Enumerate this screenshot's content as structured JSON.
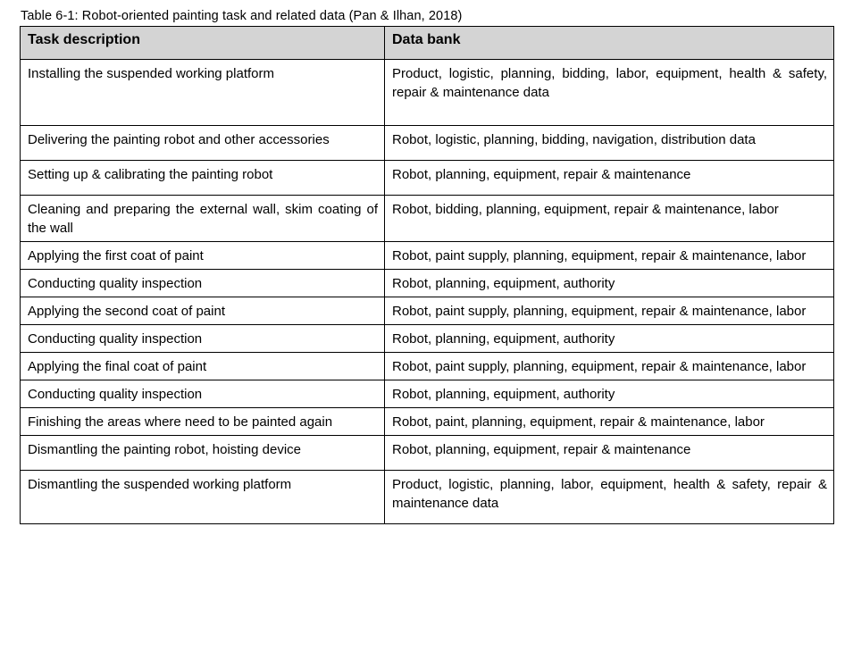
{
  "caption": "Table 6-1: Robot-oriented painting task and related data (Pan & Ilhan, 2018)",
  "table": {
    "headers": {
      "task": "Task description",
      "data_bank": "Data bank"
    },
    "rows": [
      {
        "task": "Installing the suspended working platform",
        "data_bank": "Product, logistic, planning, bidding, labor, equipment, health & safety, repair & maintenance data"
      },
      {
        "task": "Delivering the painting robot and other accessories",
        "data_bank": "Robot, logistic, planning, bidding, navigation, distribution data"
      },
      {
        "task": "Setting up & calibrating the painting robot",
        "data_bank": "Robot, planning, equipment,  repair & maintenance"
      },
      {
        "task": "Cleaning and preparing the external wall, skim coating of the wall",
        "data_bank": "Robot, bidding, planning, equipment,  repair & maintenance, labor"
      },
      {
        "task": "Applying the first coat of paint",
        "data_bank": "Robot, paint supply, planning, equipment,  repair & maintenance, labor"
      },
      {
        "task": "Conducting quality inspection",
        "data_bank": "Robot, planning, equipment, authority"
      },
      {
        "task": "Applying the second coat of paint",
        "data_bank": "Robot, paint supply, planning, equipment,  repair & maintenance, labor"
      },
      {
        "task": "Conducting quality inspection",
        "data_bank": "Robot, planning, equipment, authority"
      },
      {
        "task": "Applying the final coat of paint",
        "data_bank": "Robot, paint supply, planning, equipment,  repair & maintenance, labor"
      },
      {
        "task": "Conducting quality inspection",
        "data_bank": "Robot, planning, equipment, authority"
      },
      {
        "task": "Finishing the areas where need to be painted again",
        "data_bank": "Robot, paint, planning, equipment,  repair & maintenance, labor"
      },
      {
        "task": "Dismantling the painting robot, hoisting device",
        "data_bank": "Robot, planning, equipment,  repair & maintenance"
      },
      {
        "task": "Dismantling the suspended working platform",
        "data_bank": "Product, logistic, planning, labor, equipment, health & safety, repair & maintenance data"
      }
    ],
    "row_heights": [
      "tall",
      "mid",
      "mid",
      "short",
      "short",
      "short",
      "short",
      "short",
      "short",
      "short",
      "short",
      "mid",
      "mid"
    ],
    "colors": {
      "header_background": "#d4d4d4",
      "border": "#000000",
      "text": "#000000",
      "page_background": "#ffffff"
    }
  }
}
